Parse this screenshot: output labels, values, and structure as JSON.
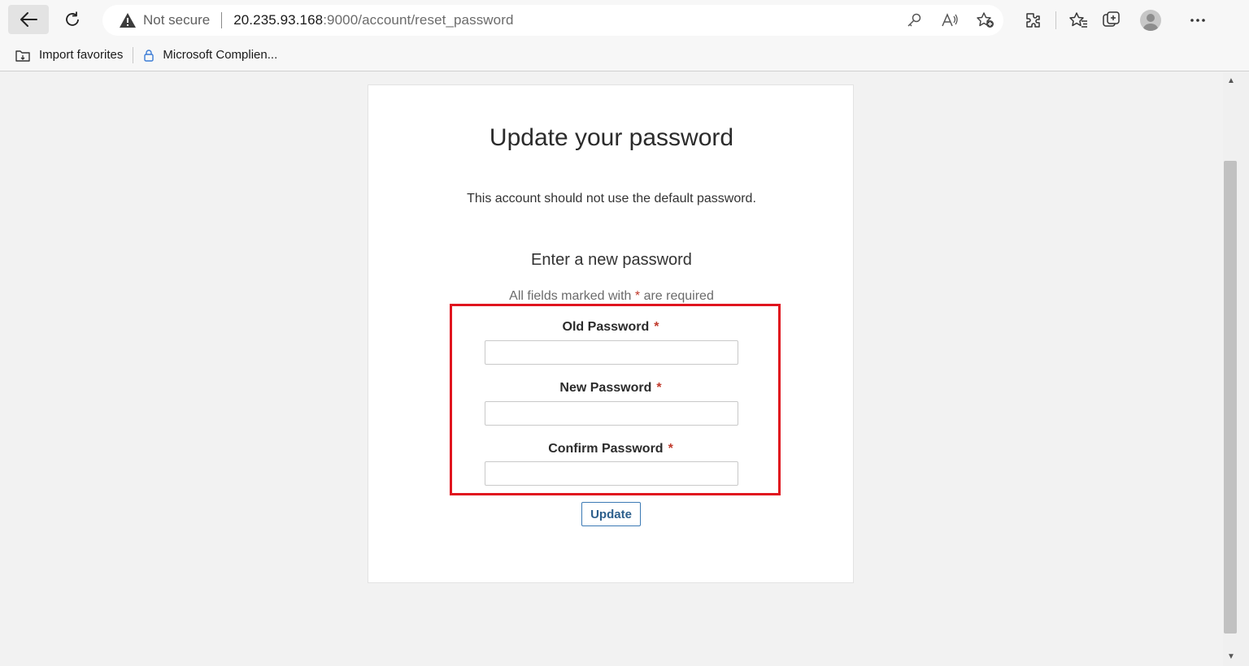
{
  "browser": {
    "not_secure_label": "Not secure",
    "url_host": "20.235.93.168",
    "url_rest": ":9000/account/reset_password",
    "icons": {
      "back": "back-arrow-icon",
      "refresh": "refresh-icon",
      "warning": "warning-icon",
      "password_key": "key-icon",
      "read_aloud": "read-aloud-icon",
      "add_favorite": "add-favorite-icon",
      "extensions": "extensions-icon",
      "favorites": "favorites-icon",
      "collections": "collections-icon",
      "profile": "profile-avatar-icon",
      "more": "more-icon"
    }
  },
  "bookmarks": {
    "items": [
      {
        "label": "Import favorites",
        "icon": "import-icon"
      },
      {
        "label": "Microsoft Complien...",
        "icon": "lock-icon"
      }
    ]
  },
  "page": {
    "title": "Update your password",
    "subtitle": "This account should not use the default password.",
    "section_title": "Enter a new password",
    "required_note_prefix": "All fields marked with",
    "required_star": "*",
    "required_note_suffix": "are required",
    "fields": [
      {
        "label": "Old Password",
        "star": "*",
        "value": ""
      },
      {
        "label": "New Password",
        "star": "*",
        "value": ""
      },
      {
        "label": "Confirm Password",
        "star": "*",
        "value": ""
      }
    ],
    "update_button": "Update"
  },
  "colors": {
    "highlight_border": "#e0141e",
    "required_star": "#c0392b",
    "button_border": "#3b79b4"
  }
}
